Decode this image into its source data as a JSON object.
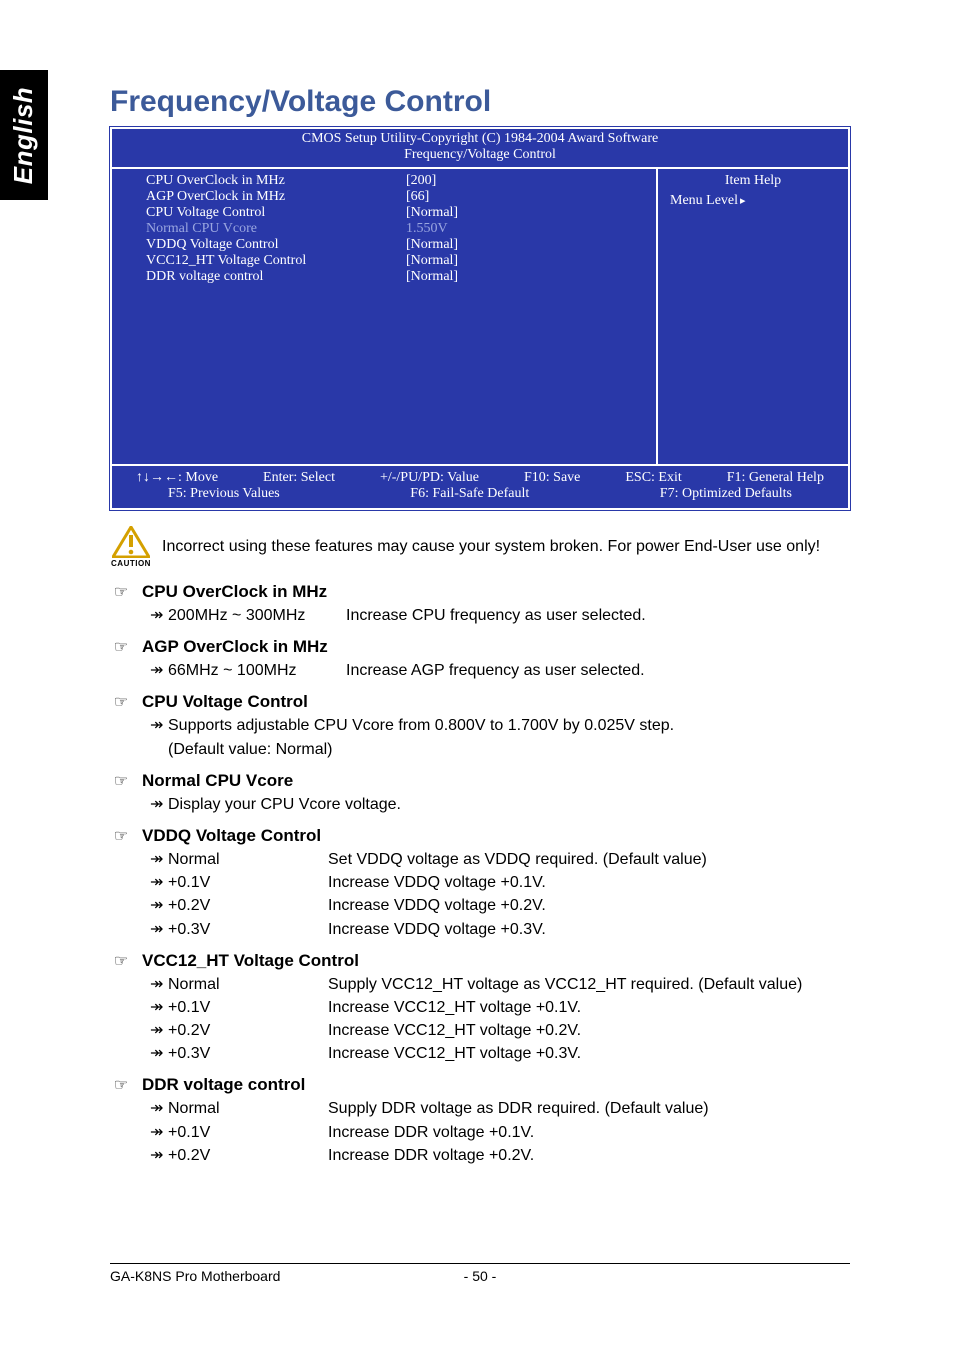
{
  "sideTab": "English",
  "title": "Frequency/Voltage Control",
  "bios": {
    "hdr1": "CMOS Setup Utility-Copyright (C) 1984-2004 Award Software",
    "hdr2": "Frequency/Voltage Control",
    "rows": [
      {
        "lbl": "CPU OverClock in MHz",
        "val": "[200]",
        "dim": false
      },
      {
        "lbl": "AGP OverClock in MHz",
        "val": "[66]",
        "dim": false
      },
      {
        "lbl": "CPU Voltage Control",
        "val": "[Normal]",
        "dim": false
      },
      {
        "lbl": "Normal CPU Vcore",
        "val": "1.550V",
        "dim": true
      },
      {
        "lbl": "VDDQ Voltage Control",
        "val": "[Normal]",
        "dim": false
      },
      {
        "lbl": "VCC12_HT Voltage Control",
        "val": "[Normal]",
        "dim": false
      },
      {
        "lbl": "DDR voltage control",
        "val": "[Normal]",
        "dim": false
      }
    ],
    "itemHelp": "Item Help",
    "menuLevel": "Menu Level",
    "ftr": {
      "r1": [
        "↑↓→←: Move",
        "Enter: Select",
        "+/-/PU/PD: Value",
        "F10: Save",
        "ESC: Exit",
        "F1: General Help"
      ],
      "r2": [
        "F5: Previous Values",
        "F6: Fail-Safe Default",
        "F7: Optimized Defaults"
      ]
    }
  },
  "caution": {
    "label": "CAUTION",
    "text": "Incorrect using these features may cause your system broken. For power End-User use only!"
  },
  "sections": [
    {
      "title": "CPU OverClock in MHz",
      "inline": {
        "range": "200MHz ~ 300MHz",
        "desc": "Increase CPU frequency as user selected."
      }
    },
    {
      "title": "AGP OverClock in MHz",
      "inline": {
        "range": "66MHz ~ 100MHz",
        "desc": "Increase AGP frequency as user selected."
      }
    },
    {
      "title": "CPU Voltage Control",
      "lines": [
        "Supports adjustable CPU Vcore from 0.800V to 1.700V by 0.025V step."
      ],
      "plain": [
        "(Default value: Normal)"
      ]
    },
    {
      "title": "Normal CPU Vcore",
      "lines": [
        "Display your CPU Vcore voltage."
      ]
    },
    {
      "title": "VDDQ Voltage Control",
      "opts": [
        {
          "k": "Normal",
          "v": "Set VDDQ voltage as VDDQ required. (Default value)"
        },
        {
          "k": "+0.1V",
          "v": "Increase VDDQ voltage +0.1V."
        },
        {
          "k": "+0.2V",
          "v": "Increase VDDQ voltage +0.2V."
        },
        {
          "k": "+0.3V",
          "v": "Increase VDDQ voltage +0.3V."
        }
      ]
    },
    {
      "title": "VCC12_HT Voltage Control",
      "opts": [
        {
          "k": "Normal",
          "v": "Supply VCC12_HT voltage as VCC12_HT required. (Default value)"
        },
        {
          "k": "+0.1V",
          "v": "Increase VCC12_HT voltage +0.1V."
        },
        {
          "k": "+0.2V",
          "v": "Increase VCC12_HT voltage +0.2V."
        },
        {
          "k": "+0.3V",
          "v": "Increase VCC12_HT voltage +0.3V."
        }
      ]
    },
    {
      "title": "DDR voltage control",
      "opts": [
        {
          "k": "Normal",
          "v": "Supply DDR voltage as DDR required. (Default value)"
        },
        {
          "k": "+0.1V",
          "v": "Increase DDR voltage +0.1V."
        },
        {
          "k": "+0.2V",
          "v": "Increase DDR voltage +0.2V."
        }
      ]
    }
  ],
  "footer": {
    "model": "GA-K8NS Pro Motherboard",
    "page": "- 50 -"
  },
  "glyph": {
    "hand": "☞",
    "arrow": "↠"
  }
}
